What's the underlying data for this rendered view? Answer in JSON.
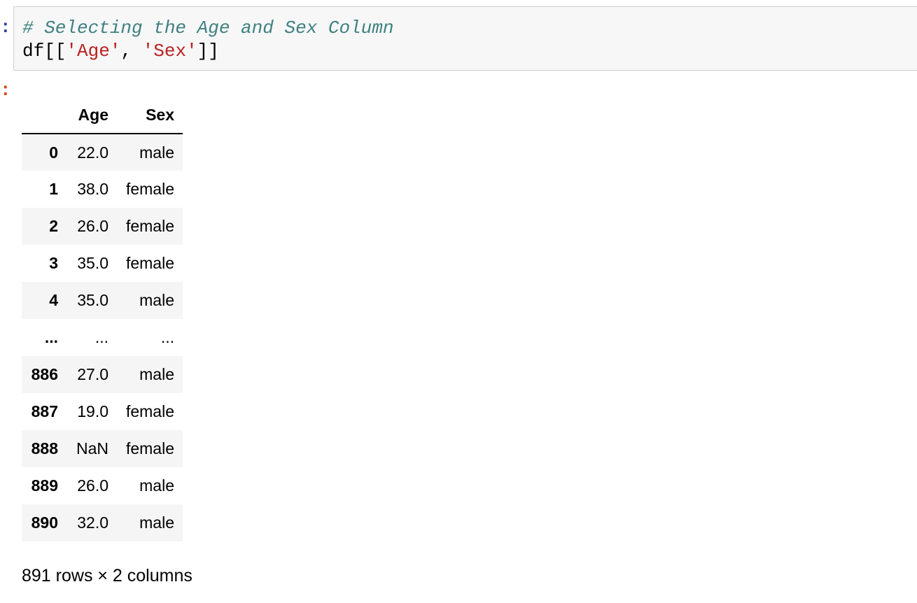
{
  "cell": {
    "input_prompt": ":",
    "output_prompt": ":",
    "code": {
      "comment": "# Selecting the Age and Sex Column",
      "line2_prefix": "df[[",
      "string1": "'Age'",
      "separator": ", ",
      "string2": "'Sex'",
      "line2_suffix": "]]"
    }
  },
  "table": {
    "index_header": "",
    "columns": [
      "Age",
      "Sex"
    ],
    "rows": [
      {
        "index": "0",
        "age": "22.0",
        "sex": "male"
      },
      {
        "index": "1",
        "age": "38.0",
        "sex": "female"
      },
      {
        "index": "2",
        "age": "26.0",
        "sex": "female"
      },
      {
        "index": "3",
        "age": "35.0",
        "sex": "female"
      },
      {
        "index": "4",
        "age": "35.0",
        "sex": "male"
      },
      {
        "index": "...",
        "age": "...",
        "sex": "..."
      },
      {
        "index": "886",
        "age": "27.0",
        "sex": "male"
      },
      {
        "index": "887",
        "age": "19.0",
        "sex": "female"
      },
      {
        "index": "888",
        "age": "NaN",
        "sex": "female"
      },
      {
        "index": "889",
        "age": "26.0",
        "sex": "male"
      },
      {
        "index": "890",
        "age": "32.0",
        "sex": "male"
      }
    ],
    "shape_text": "891 rows × 2 columns"
  },
  "colors": {
    "input_prompt": "#303f9f",
    "output_prompt": "#d84315",
    "comment": "#408080",
    "string": "#ba2121",
    "cell_background": "#f7f7f7",
    "row_stripe": "#f5f5f5"
  }
}
